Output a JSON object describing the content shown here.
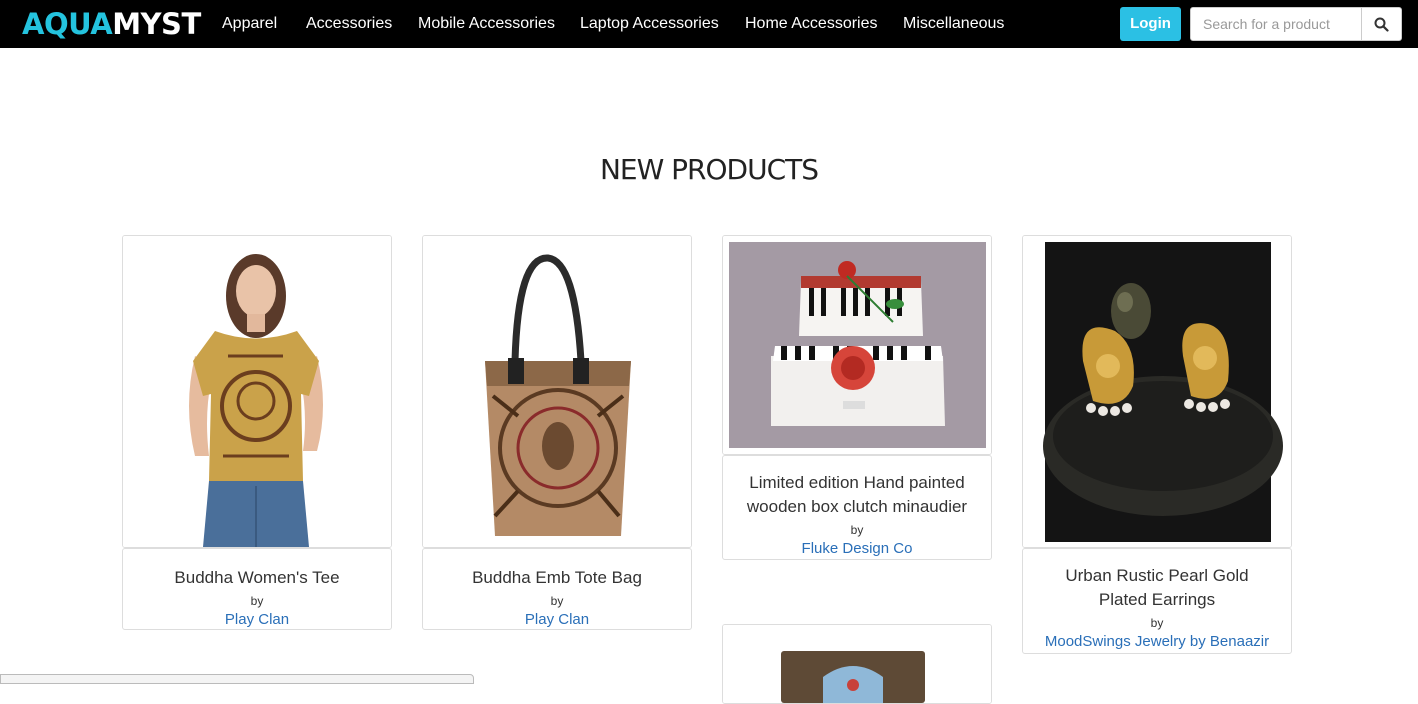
{
  "brand": {
    "aqua": "AQUA",
    "myst": "MYST"
  },
  "nav": {
    "items": [
      "Apparel",
      "Accessories",
      "Mobile Accessories",
      "Laptop Accessories",
      "Home Accessories",
      "Miscellaneous"
    ]
  },
  "header": {
    "login_label": "Login",
    "search_placeholder": "Search for a product",
    "search_icon": "search-icon"
  },
  "section": {
    "title": "NEW PRODUCTS"
  },
  "products": [
    {
      "name": "Buddha Women's Tee",
      "by": "by",
      "brand": "Play Clan"
    },
    {
      "name": "Buddha Emb Tote Bag",
      "by": "by",
      "brand": "Play Clan"
    },
    {
      "name": "Limited edition Hand painted wooden box clutch minaudier",
      "by": "by",
      "brand": "Fluke Design Co"
    },
    {
      "name": "Urban Rustic Pearl Gold Plated Earrings",
      "by": "by",
      "brand": "MoodSwings Jewelry by Benaazir"
    }
  ],
  "colors": {
    "accent": "#2bc0e4",
    "navbar": "#000000",
    "link": "#2a6fb8"
  }
}
